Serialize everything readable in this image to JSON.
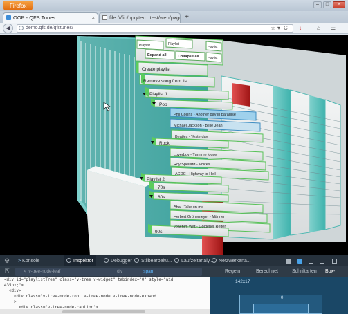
{
  "browser": {
    "menu_button_label": "Firefox",
    "window_controls": [
      "–",
      "□",
      "×"
    ]
  },
  "tabs": [
    {
      "title": "OOP - QFS Tunes",
      "close": "×"
    },
    {
      "title": "file:///fic/npq/teu...test/web/page.html",
      "close": "×"
    }
  ],
  "newtab_label": "+",
  "navbar": {
    "back": "◀",
    "url": "demo.qfs.de/qfstunes/",
    "right_icons": [
      "☆",
      "▾",
      "C",
      "↓",
      "⌂",
      "☰"
    ]
  },
  "tree3d": {
    "toolbar_buttons": [
      "Playlist",
      "Playlist",
      "Expand all",
      "Collapse all",
      "Playlist",
      "Playlist"
    ],
    "create_playlist": "Create playlist",
    "remove_song": "Remove song from list",
    "playlist1": "Playlist 1",
    "pop": "Pop",
    "phil": "Phil Collins - Another day in paradise",
    "michael": "Michael Jackson - Billie Jean",
    "beatles": "Beatles - Yesterday",
    "rock": "Rock",
    "loverboy": "Loverboy - Turn me loose",
    "roy": "Roy Spellard - Voices",
    "acdc": "ACDC - Highway to Hell",
    "playlist2": "Playlist 2",
    "seventies": "70s",
    "eighties": "80s",
    "aha": "Aha - Take on me",
    "herbert": "Herbert Grönemeyer - Männer",
    "joachim": "Joachim Witt - Goldener Reiter",
    "nineties": "90s"
  },
  "devtools": {
    "tabs": [
      "Konsole",
      "Inspektor",
      "Debugger",
      "Stilbearbeitu...",
      "Laufzeitanaly...",
      "Netzwerkana..."
    ],
    "breadcrumb": "< .v-tree-node-leaf",
    "breadcrumb_mid": "div",
    "breadcrumb_selected": "span",
    "side_tabs": [
      "Regeln",
      "Berechnet",
      "Schriftarten",
      "Box-Model"
    ],
    "markup_lines": [
      "<div id=\"playlistTree\" class=\"v-tree v-widget\" tabindex=\"0\" style=\"wid",
      "435px;\">",
      "  <div>",
      "    <div class=\"v-tree-node-root v-tree-node v-tree-node-expand",
      "    >",
      "      <div class=\"v-tree-node-caption\">"
    ],
    "box_size": "142x17",
    "box_margin_label": "0"
  }
}
